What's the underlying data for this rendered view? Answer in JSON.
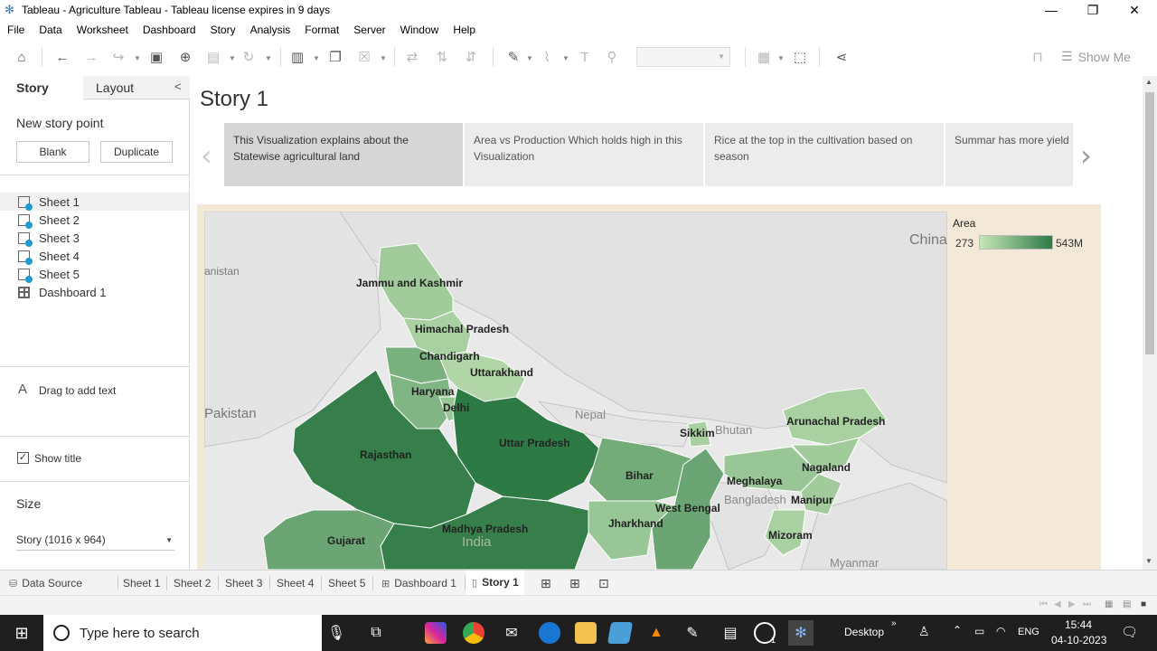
{
  "window": {
    "title": "Tableau - Agriculture Tableau - Tableau license expires in 9 days",
    "min": "—",
    "max": "❐",
    "close": "✕"
  },
  "menu": [
    "File",
    "Data",
    "Worksheet",
    "Dashboard",
    "Story",
    "Analysis",
    "Format",
    "Server",
    "Window",
    "Help"
  ],
  "toolbar": {
    "show_me": "Show Me"
  },
  "leftpane": {
    "tab_story": "Story",
    "tab_layout": "Layout",
    "new_story_point": "New story point",
    "blank": "Blank",
    "duplicate": "Duplicate",
    "sheets": [
      "Sheet 1",
      "Sheet 2",
      "Sheet 3",
      "Sheet 4",
      "Sheet 5"
    ],
    "dashboard": "Dashboard 1",
    "drag_text": "Drag to add text",
    "drag_icon": "A",
    "show_title": "Show title",
    "size_label": "Size",
    "size_value": "Story (1016 x 964)"
  },
  "story": {
    "title": "Story 1",
    "captions": [
      "This Visualization explains about the Statewise agricultural land",
      "Area vs Production Which holds  high in this Visualization",
      "Rice at the top in the cultivation based on season",
      "Summar has more yield"
    ]
  },
  "map": {
    "legend_title": "Area",
    "legend_min": "273",
    "legend_max": "543M",
    "scale_colors": [
      "#c7e6b8",
      "#2e7a45"
    ],
    "states": [
      {
        "name": "Jammu and Kashmir",
        "shade": 0.25
      },
      {
        "name": "Himachal Pradesh",
        "shade": 0.2
      },
      {
        "name": "Chandigarh",
        "shade": 0.5
      },
      {
        "name": "Uttarakhand",
        "shade": 0.15
      },
      {
        "name": "Haryana",
        "shade": 0.45
      },
      {
        "name": "Delhi",
        "shade": 0.3
      },
      {
        "name": "Rajasthan",
        "shade": 0.95
      },
      {
        "name": "Uttar Pradesh",
        "shade": 1.0
      },
      {
        "name": "Bihar",
        "shade": 0.55
      },
      {
        "name": "Sikkim",
        "shade": 0.2
      },
      {
        "name": "Arunachal Pradesh",
        "shade": 0.2
      },
      {
        "name": "Nagaland",
        "shade": 0.25
      },
      {
        "name": "Meghalaya",
        "shade": 0.3
      },
      {
        "name": "Manipur",
        "shade": 0.25
      },
      {
        "name": "West Bengal",
        "shade": 0.6
      },
      {
        "name": "Jharkhand",
        "shade": 0.3
      },
      {
        "name": "Mizoram",
        "shade": 0.2
      },
      {
        "name": "Madhya Pradesh",
        "shade": 0.95
      },
      {
        "name": "Gujarat",
        "shade": 0.6
      }
    ],
    "countries": [
      "China",
      "Pakistan",
      "Nepal",
      "Bhutan",
      "Bangladesh",
      "India",
      "Myanmar"
    ],
    "partial_label": "anistan"
  },
  "bottom_tabs": {
    "data_source": "Data Source",
    "sheets": [
      "Sheet 1",
      "Sheet 2",
      "Sheet 3",
      "Sheet 4",
      "Sheet 5"
    ],
    "dashboard": "Dashboard 1",
    "story": "Story 1"
  },
  "taskbar": {
    "search_placeholder": "Type here to search",
    "desktop": "Desktop",
    "lang": "ENG",
    "time": "15:44",
    "date": "04-10-2023",
    "chrome_badge": "1"
  }
}
